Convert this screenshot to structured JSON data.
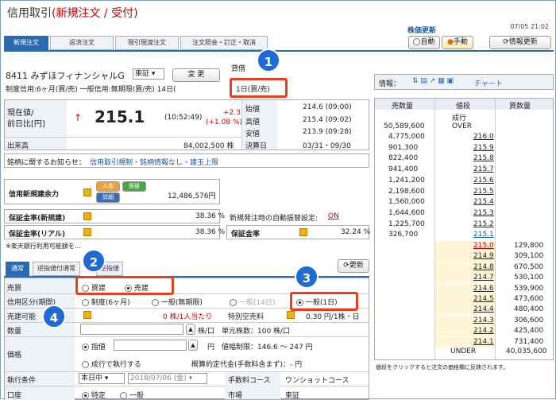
{
  "header": {
    "title_prefix": "信用取引",
    "title_suffix": "(新規注文 / 受付)",
    "timestamp": "07/05 21:02",
    "price_update_label": "株価更新"
  },
  "tabs": [
    "新規注文",
    "返済注文",
    "現引現渡注文",
    "注文照会・訂正・取消"
  ],
  "update_controls": {
    "auto": "自動",
    "manual": "手動",
    "refresh": "情報更新"
  },
  "stock": {
    "code_name": "8411 みずほフィナンシャルG",
    "market": "東証",
    "change_btn": "変 更",
    "extra": "貸借",
    "info_line": "制度信用:6ヶ月(買/売)  一般信用:無期限(買/売)  14日(",
    "info_highlight": "1日(買/売)"
  },
  "quote": {
    "label1": "現在値/",
    "label2": "前日比[円]",
    "arrow": "↑",
    "price": "215.1",
    "time": "(10:52:49)",
    "change": "+2.3",
    "change_pct": "(+1.08 %)",
    "volume_label": "出来高",
    "volume": "84,002,500 株",
    "rows": [
      {
        "k": "始値",
        "v": "214.6 (09:00)"
      },
      {
        "k": "高値",
        "v": "215.4 (09:02)"
      },
      {
        "k": "安値",
        "v": "213.9 (09:28)"
      },
      {
        "k": "決算日",
        "v": "03/31・09/30"
      }
    ]
  },
  "notice": {
    "label": "銘柄に関するお知らせ：",
    "value": "信用取引規制・銘柄情報なし・建玉上限"
  },
  "capacity": {
    "label": "信用新規建余力",
    "btn_deposit": "入金",
    "btn_transfer": "振替",
    "btn_detail": "詳細",
    "value": "12,486,576円",
    "margin_new_label": "保証金率(新規建)",
    "margin_new": "38.36 %",
    "auto_label": "新規発注時の自動振替設定:",
    "auto_value": "ON",
    "margin_real_label": "保証金率(リアル)",
    "margin_real": "38.36 %",
    "margin_label": "保証金率",
    "margin": "32.24 %",
    "footnote": "※楽天銀行利用可能額を…"
  },
  "order": {
    "tab1": "通常",
    "tab2": "逆指値付通常",
    "tab3": "逆指値",
    "refresh": "更新",
    "side_label": "売買",
    "buy": "買建",
    "sell": "売建",
    "type_label": "信用区分(期間)",
    "t1": "制度(6ヶ月)",
    "t2": "一般(無期限)",
    "t3": "一般(14日)",
    "t4": "一般(1日)",
    "avail_label": "売建可能",
    "avail_value": "0 株/1人当たり",
    "fee_label": "特別空売料",
    "fee_value": "0.30 円/1株・日",
    "qty_label": "数量",
    "qty_unit": "株/口",
    "unit_shares": "単元株数：100 株/口",
    "price_label": "価格",
    "limit": "指値",
    "limit_unit": "円",
    "limit_range": "値幅制限：146.6 ～ 247 円",
    "market": "成行で執行する",
    "est": "概算約定代金(手数料含まず)：- 円",
    "cond_label": "執行条件",
    "cond_value": "本日中",
    "date_value": "2018/07/06 (金)",
    "fee_course_label": "手数料コース",
    "fee_course": "ワンショットコース",
    "acct_label": "口座",
    "acct1": "特定",
    "acct2": "一般",
    "mkt_label": "市場",
    "mkt_value": "東証"
  },
  "board": {
    "info_label": "情報：",
    "chart": "チャート",
    "headers": [
      "売数量",
      "値段",
      "買数量"
    ],
    "market_row": "成行",
    "over_qty": "50,589,600",
    "over": "OVER",
    "asks": [
      [
        "4,775,000",
        "216.0"
      ],
      [
        "901,300",
        "215.9"
      ],
      [
        "822,400",
        "215.8"
      ],
      [
        "941,400",
        "215.7"
      ],
      [
        "1,241,200",
        "215.6"
      ],
      [
        "2,198,600",
        "215.5"
      ],
      [
        "1,560,000",
        "215.4"
      ],
      [
        "1,644,600",
        "215.3"
      ],
      [
        "1,225,700",
        "215.2"
      ],
      [
        "326,700",
        "215.1"
      ]
    ],
    "bids": [
      [
        "215.0",
        "129,800"
      ],
      [
        "214.9",
        "309,100"
      ],
      [
        "214.8",
        "670,500"
      ],
      [
        "214.7",
        "530,100"
      ],
      [
        "214.6",
        "539,900"
      ],
      [
        "214.5",
        "473,600"
      ],
      [
        "214.4",
        "480,400"
      ],
      [
        "214.3",
        "306,600"
      ],
      [
        "214.2",
        "425,400"
      ],
      [
        "214.1",
        "731,400"
      ]
    ],
    "under": "UNDER",
    "under_qty": "40,035,600",
    "footer": "値段をクリックすると注文の価格欄に反映されます。"
  },
  "callouts": [
    "1",
    "2",
    "3",
    "4"
  ],
  "colors": {
    "accent": "#2c6ab0",
    "callout": "#1f6bd6",
    "highlight": "#e8401c",
    "price_red": "#d00000"
  }
}
